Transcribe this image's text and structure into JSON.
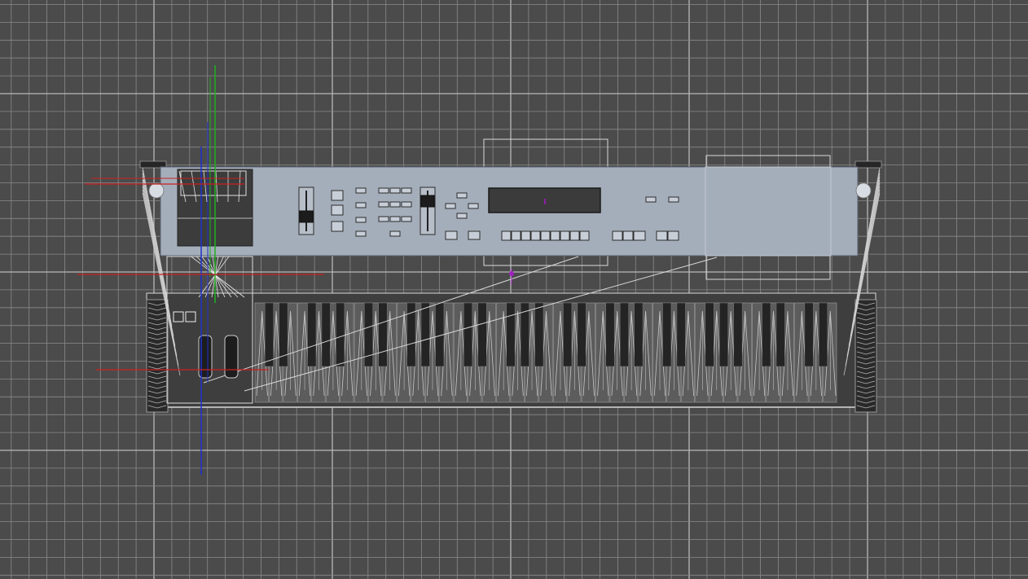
{
  "viewport": {
    "view": "top",
    "display_mode": "wireframe-shaded",
    "grid_visible": true,
    "colors": {
      "background": "#4b4b4b",
      "grid_minor": "#8a8a8a",
      "grid_major": "#b8b8b8",
      "axis_x": "#cc2020",
      "axis_y": "#20b020",
      "axis_z": "#2030d0",
      "panel_fill": "#a4aeba",
      "wire": "#d8d8d8"
    }
  },
  "model": {
    "object": "synthesizer-keyboard",
    "key_count": 61,
    "sliders": 2,
    "display_lcd": true
  }
}
